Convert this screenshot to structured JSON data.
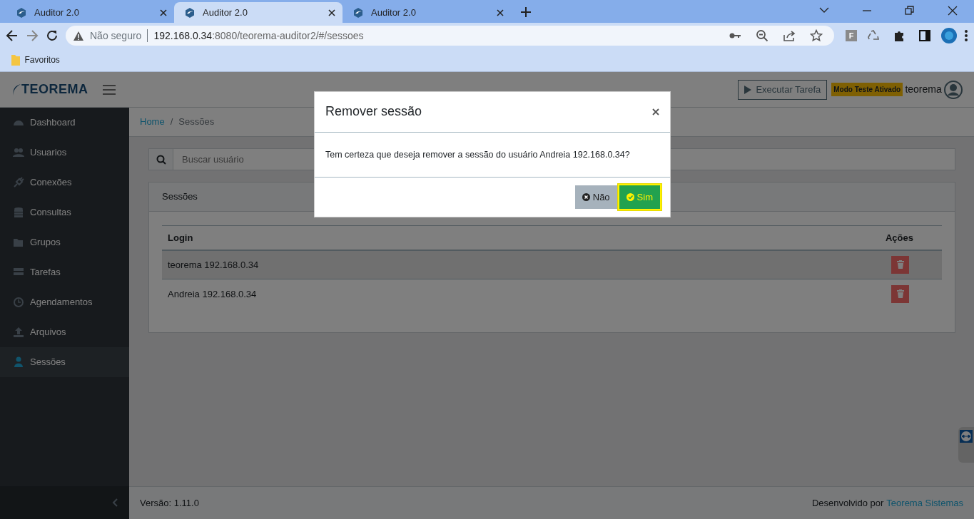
{
  "browser": {
    "tabs": [
      {
        "title": "Auditor 2.0",
        "selected": false
      },
      {
        "title": "Auditor 2.0",
        "selected": true
      },
      {
        "title": "Auditor 2.0",
        "selected": false
      }
    ],
    "security": "Não seguro",
    "url_host": "192.168.0.34",
    "url_rest": ":8080/teorema-auditor2/#/sessoes",
    "extension_letter": "F",
    "bookmarks": [
      "Favoritos"
    ]
  },
  "header": {
    "logo": "TEOREMA",
    "run_button": "Executar Tarefa",
    "mode_badge": "Modo Teste Ativado",
    "user": "teorema"
  },
  "sidebar": {
    "items": [
      {
        "label": "Dashboard",
        "selected": false
      },
      {
        "label": "Usuarios",
        "selected": false
      },
      {
        "label": "Conexões",
        "selected": false
      },
      {
        "label": "Consultas",
        "selected": false
      },
      {
        "label": "Grupos",
        "selected": false
      },
      {
        "label": "Tarefas",
        "selected": false
      },
      {
        "label": "Agendamentos",
        "selected": false
      },
      {
        "label": "Arquivos",
        "selected": false
      },
      {
        "label": "Sessões",
        "selected": true
      }
    ]
  },
  "breadcrumb": {
    "items": [
      "Home",
      "Sessões"
    ],
    "separator": "/"
  },
  "search": {
    "placeholder": "Buscar usuário"
  },
  "card": {
    "title": "Sessões",
    "table": {
      "columns": [
        "Login",
        "Ações"
      ],
      "rows": [
        {
          "login": "teorema 192.168.0.34"
        },
        {
          "login": "Andreia 192.168.0.34"
        }
      ]
    }
  },
  "footer": {
    "version": "Versão: 1.11.0",
    "credit": "Desenvolvido por",
    "credit_link": "Teorema Sistemas"
  },
  "modal": {
    "title": "Remover sessão",
    "message": "Tem certeza que deseja remover a sessão do usuário Andreia 192.168.0.34?",
    "buttons": [
      {
        "label": "Não",
        "kind": "cancel",
        "focused": false
      },
      {
        "label": "Sim",
        "kind": "confirm",
        "focused": true
      }
    ]
  }
}
